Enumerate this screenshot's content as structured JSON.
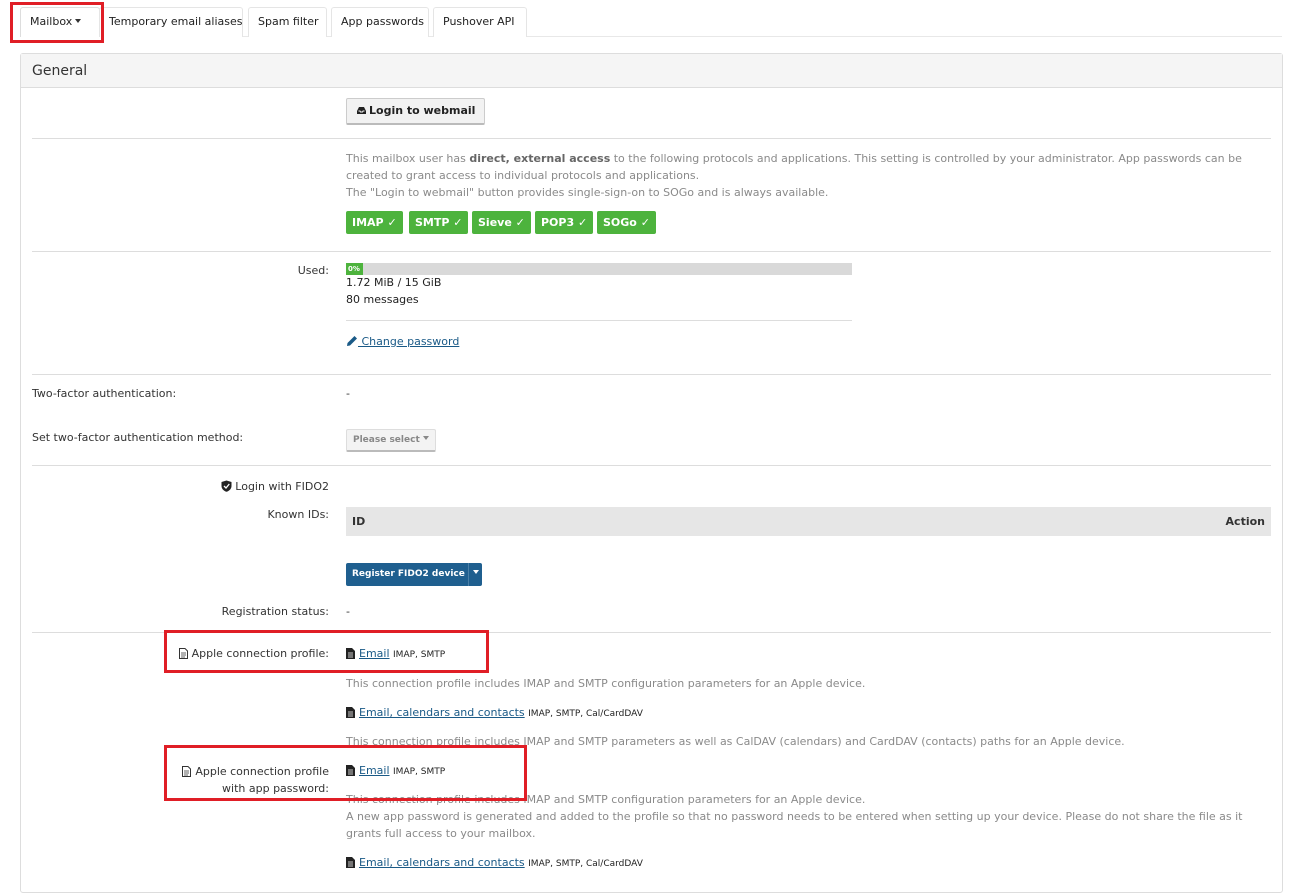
{
  "tabs": [
    {
      "label": "Mailbox"
    },
    {
      "label": "Temporary email aliases"
    },
    {
      "label": "Spam filter"
    },
    {
      "label": "App passwords"
    },
    {
      "label": "Pushover API"
    }
  ],
  "panel": {
    "title": "General"
  },
  "webmail": {
    "button_label": "Login to webmail"
  },
  "access": {
    "text_pre": "This mailbox user has ",
    "text_bold": "direct, external access",
    "text_post": " to the following protocols and applications. This setting is controlled by your administrator. App passwords can be created to grant access to individual protocols and applications.",
    "sso_note": "The \"Login to webmail\" button provides single-sign-on to SOGo and is always available.",
    "protocols": [
      "IMAP ✓",
      "SMTP ✓",
      "Sieve ✓",
      "POP3 ✓",
      "SOGo ✓"
    ]
  },
  "usage": {
    "label": "Used:",
    "percent_text": "0%",
    "percent": 0,
    "size": "1.72 MiB / 15 GiB",
    "messages": "80 messages"
  },
  "change_password": {
    "label": " Change password"
  },
  "tfa": {
    "label": "Two-factor authentication:",
    "value": "-",
    "method_label": "Set two-factor authentication method:",
    "select_placeholder": "Please select"
  },
  "fido": {
    "title": "Login with FIDO2",
    "known_ids_label": "Known IDs:",
    "col_id": "ID",
    "col_action": "Action",
    "register_button": "Register FIDO2 device",
    "status_label": "Registration status:",
    "status_value": "-"
  },
  "apple_profile": {
    "label": "Apple connection profile:",
    "email_link": "Email",
    "email_protocols": "IMAP, SMTP",
    "email_desc": "This connection profile includes IMAP and SMTP configuration parameters for an Apple device.",
    "full_link": "Email, calendars and contacts",
    "full_protocols": "IMAP, SMTP, Cal/CardDAV",
    "full_desc": "This connection profile includes IMAP and SMTP parameters as well as CalDAV (calendars) and CardDAV (contacts) paths for an Apple device."
  },
  "apple_profile_app": {
    "label_line1": "Apple connection profile",
    "label_line2": "with app password:",
    "email_link": "Email",
    "email_protocols": "IMAP, SMTP",
    "email_desc": "This connection profile includes IMAP and SMTP configuration parameters for an Apple device.",
    "warning": "A new app password is generated and added to the profile so that no password needs to be entered when setting up your device. Please do not share the file as it grants full access to your mailbox.",
    "full_link": "Email, calendars and contacts",
    "full_protocols": "IMAP, SMTP, Cal/CardDAV"
  },
  "colors": {
    "highlight": "#e01e26",
    "success": "#4db33d",
    "primary": "#1f5f8f",
    "link": "#1a5a87"
  }
}
